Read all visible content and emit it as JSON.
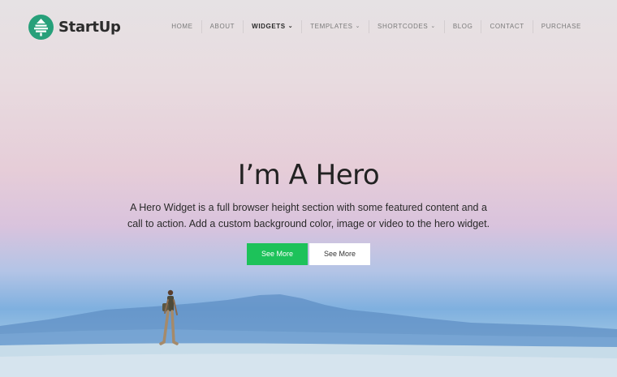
{
  "header": {
    "logo_text": "StartUp",
    "logo_icon": "pine-tree-logo-icon",
    "brand_color": "#27a07a"
  },
  "nav": {
    "items": [
      {
        "label": "HOME"
      },
      {
        "label": "ABOUT"
      },
      {
        "label": "WIDGETS",
        "active": true,
        "dropdown": true
      },
      {
        "label": "TEMPLATES",
        "dropdown": true
      },
      {
        "label": "SHORTCODES",
        "dropdown": true
      },
      {
        "label": "BLOG"
      },
      {
        "label": "CONTACT"
      },
      {
        "label": "PURCHASE"
      }
    ]
  },
  "hero": {
    "title": "I’m A Hero",
    "subtitle": "A Hero Widget is a full browser height section with some featured content and a call to action. Add a custom background color, image or video to the hero widget.",
    "primary_button": "See More",
    "secondary_button": "See More",
    "primary_color": "#1dc25a"
  }
}
